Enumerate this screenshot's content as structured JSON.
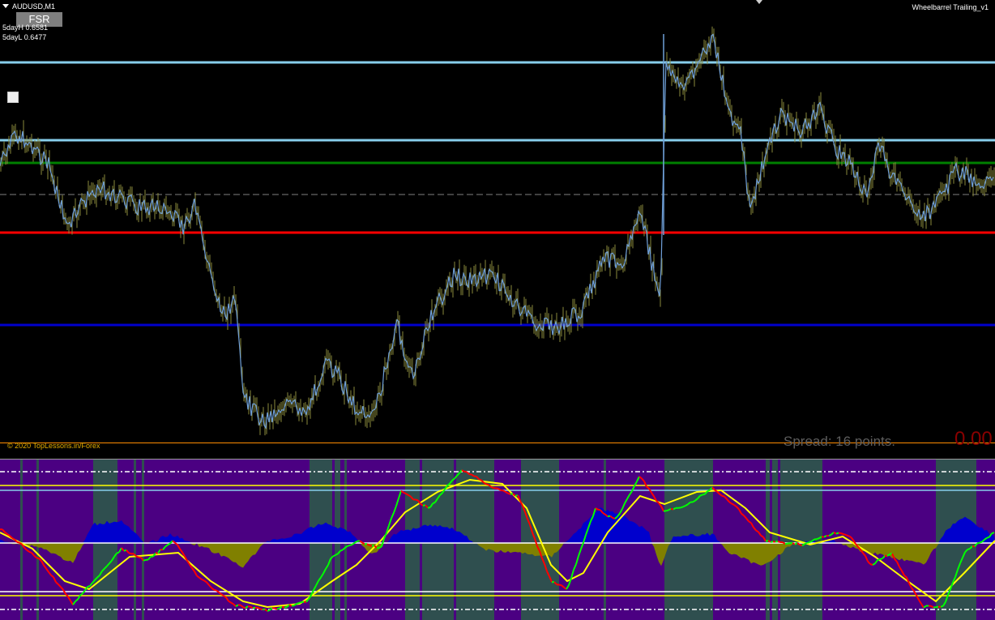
{
  "chart": {
    "symbol_timeframe": "AUDUSD,M1",
    "fsr_button": "FSR",
    "five_day_high": "5dayH 0.6581",
    "five_day_low": "5dayL 0.6477",
    "expert_name": "Wheelbarrel Trailing_v1",
    "copyright": "© 2020 TopLessons.in/Forex",
    "spread": "Spread: 16 points.",
    "spread_value": "0.00",
    "background": "#000000",
    "price_line_color": "#6f9fd8",
    "candle_wick_color": "#8a8a3c"
  },
  "levels": [
    {
      "name": "level-light-blue-top",
      "color": "#87ceeb"
    },
    {
      "name": "level-light-blue-mid",
      "color": "#87ceeb"
    },
    {
      "name": "level-green",
      "color": "#008000"
    },
    {
      "name": "level-dashed-gray",
      "color": "#808080"
    },
    {
      "name": "level-red",
      "color": "#ff0000"
    },
    {
      "name": "level-blue",
      "color": "#0000cd"
    }
  ],
  "indicator": {
    "zone_colors": {
      "purple": "#4b0082",
      "teal": "#2f4f4f"
    },
    "histogram_positive": "#0000cd",
    "histogram_negative": "#808000",
    "fast_line_green": "#00ff00",
    "fast_line_red": "#ff0000",
    "slow_line": "#ffff00",
    "band_lines": "#ffff00"
  }
}
